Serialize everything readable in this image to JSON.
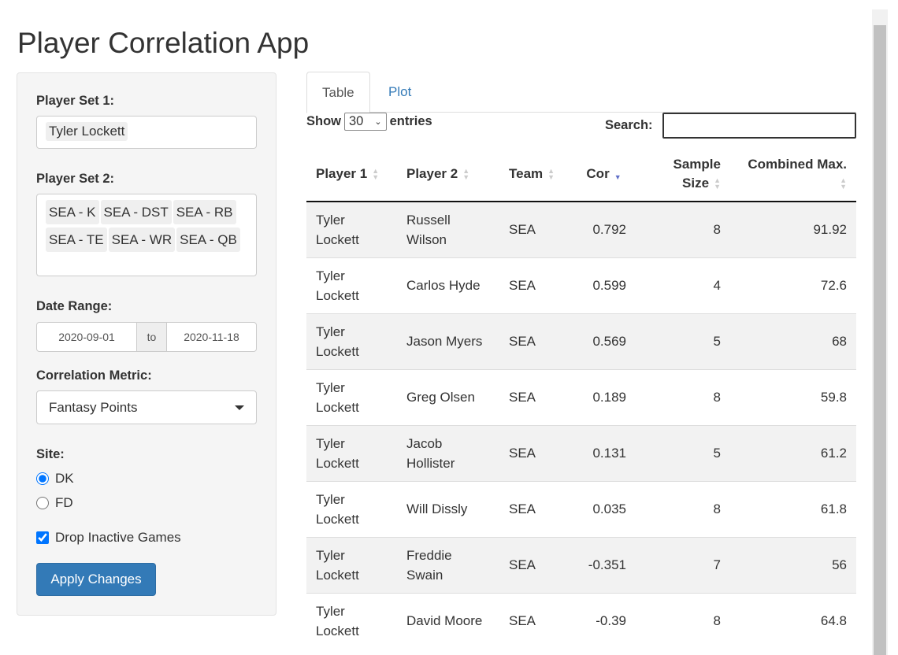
{
  "title": "Player Correlation App",
  "sidebar": {
    "player_set_1_label": "Player Set 1:",
    "player_set_1": [
      "Tyler Lockett"
    ],
    "player_set_2_label": "Player Set 2:",
    "player_set_2": [
      "SEA - K",
      "SEA - DST",
      "SEA - RB",
      "SEA - TE",
      "SEA - WR",
      "SEA - QB"
    ],
    "date_range_label": "Date Range:",
    "date_start": "2020-09-01",
    "date_sep": "to",
    "date_end": "2020-11-18",
    "metric_label": "Correlation Metric:",
    "metric_value": "Fantasy Points",
    "site_label": "Site:",
    "site_options": [
      "DK",
      "FD"
    ],
    "site_selected": "DK",
    "drop_inactive_label": "Drop Inactive Games",
    "drop_inactive": true,
    "apply_label": "Apply Changes"
  },
  "tabs": [
    "Table",
    "Plot"
  ],
  "table_controls": {
    "show": "Show",
    "entries_value": "30",
    "entries": "entries",
    "search_label": "Search:",
    "search_value": ""
  },
  "table": {
    "columns": [
      "Player 1",
      "Player 2",
      "Team",
      "Cor",
      "Sample Size",
      "Combined Max."
    ],
    "sorted_column": "Cor",
    "sort_direction": "desc",
    "rows": [
      [
        "Tyler Lockett",
        "Russell Wilson",
        "SEA",
        "0.792",
        "8",
        "91.92"
      ],
      [
        "Tyler Lockett",
        "Carlos Hyde",
        "SEA",
        "0.599",
        "4",
        "72.6"
      ],
      [
        "Tyler Lockett",
        "Jason Myers",
        "SEA",
        "0.569",
        "5",
        "68"
      ],
      [
        "Tyler Lockett",
        "Greg Olsen",
        "SEA",
        "0.189",
        "8",
        "59.8"
      ],
      [
        "Tyler Lockett",
        "Jacob Hollister",
        "SEA",
        "0.131",
        "5",
        "61.2"
      ],
      [
        "Tyler Lockett",
        "Will Dissly",
        "SEA",
        "0.035",
        "8",
        "61.8"
      ],
      [
        "Tyler Lockett",
        "Freddie Swain",
        "SEA",
        "-0.351",
        "7",
        "56"
      ],
      [
        "Tyler Lockett",
        "David Moore",
        "SEA",
        "-0.39",
        "8",
        "64.8"
      ]
    ]
  }
}
